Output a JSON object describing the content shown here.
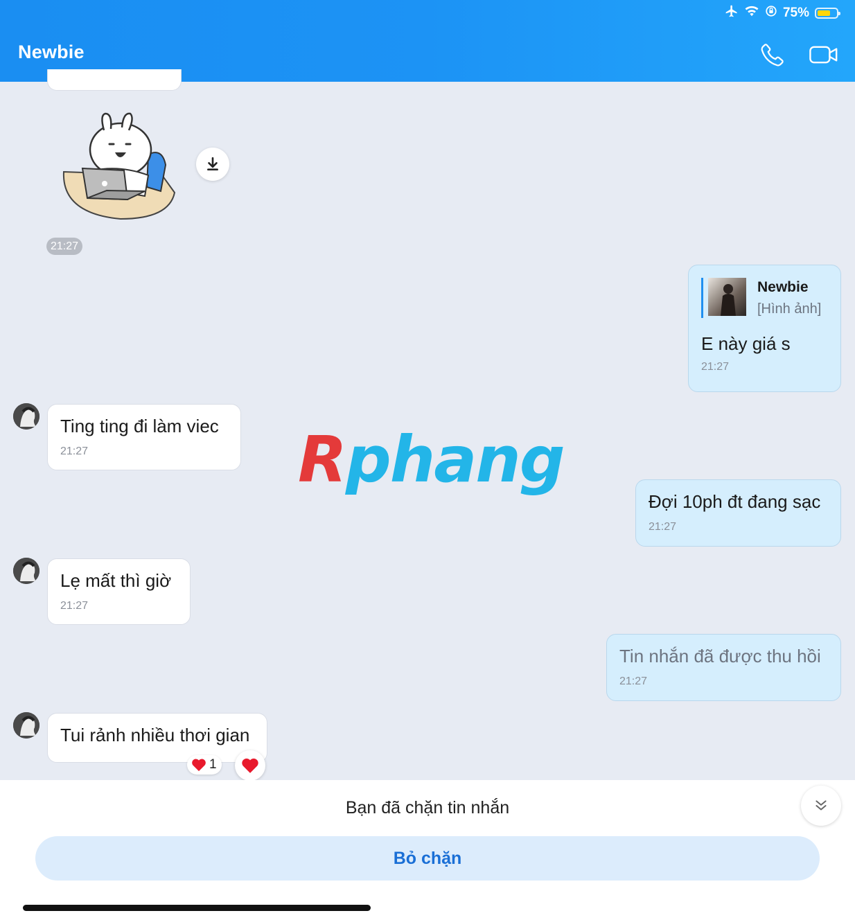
{
  "status_bar": {
    "battery_percent": "75%",
    "battery_level": 0.75,
    "icons": [
      "airplane-icon",
      "wifi-icon",
      "orientation-lock-icon",
      "battery-icon"
    ]
  },
  "header": {
    "title": "Newbie",
    "call_icon": "phone-icon",
    "video_icon": "video-camera-icon"
  },
  "messages": [
    {
      "side": "in",
      "type": "sticker",
      "time": "21:27"
    },
    {
      "side": "out",
      "type": "reply",
      "quote_name": "Newbie",
      "quote_text": "[Hình ảnh]",
      "text": "E này giá s",
      "time": "21:27"
    },
    {
      "side": "in",
      "text": "Ting ting đi làm viec",
      "time": "21:27"
    },
    {
      "side": "out",
      "text": "Đợi 10ph đt đang sạc",
      "time": "21:27"
    },
    {
      "side": "in",
      "text": "Lẹ mất thì  giờ",
      "time": "21:27"
    },
    {
      "side": "out",
      "text": "Tin nhắn đã được thu hồi",
      "time": "21:27",
      "recalled": true
    },
    {
      "side": "in",
      "text": "Tui rảnh nhiều thơi gian",
      "reaction_count": "1"
    }
  ],
  "watermark": {
    "first": "R",
    "rest": "phang"
  },
  "footer": {
    "blocked_text": "Bạn đã chặn tin nhắn",
    "unblock_label": "Bỏ chặn"
  },
  "colors": {
    "header": "#1a8ef2",
    "chat_bg": "#e7ebf3",
    "outgoing": "#d5eefd",
    "incoming": "#ffffff",
    "accent": "#1a6fd6"
  }
}
